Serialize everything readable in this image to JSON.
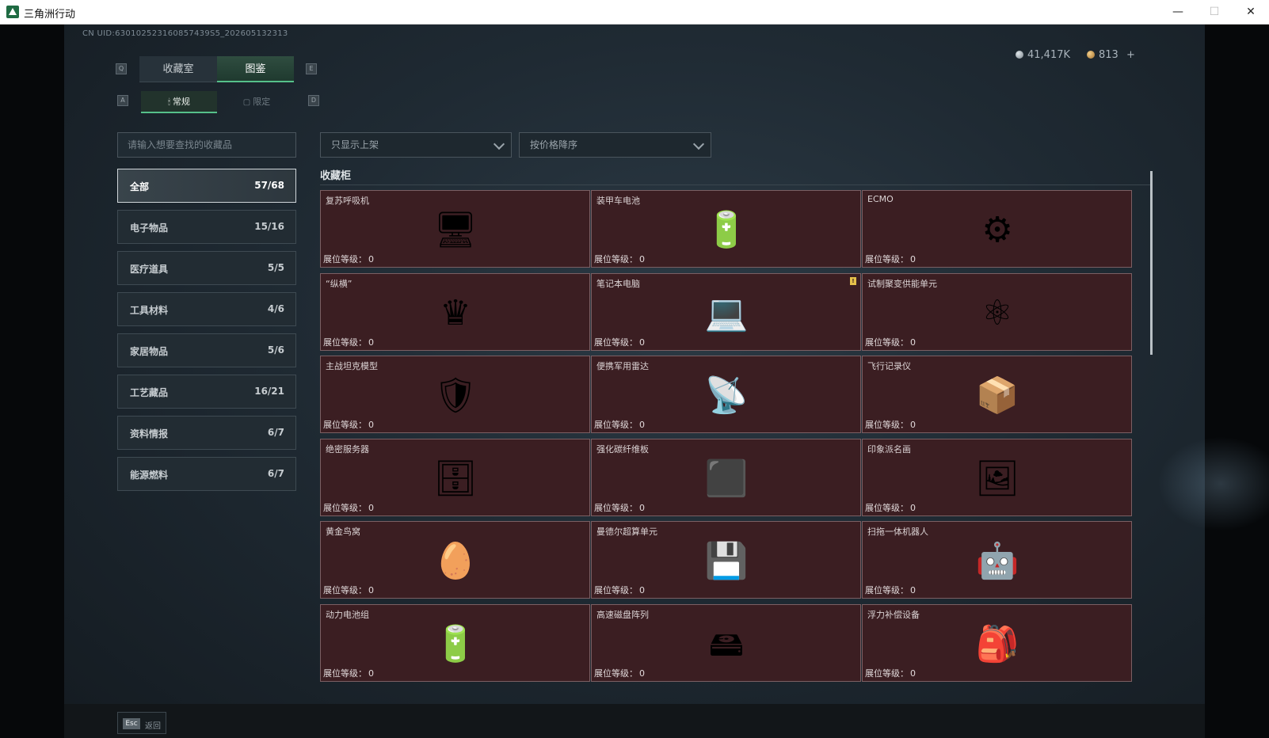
{
  "window": {
    "title": "三角洲行动",
    "minimize": "—",
    "maximize": "☐",
    "close": "✕"
  },
  "header": {
    "uid": "CN UID:630102523160857439S5_202605132313",
    "currency_silver": "41,417K",
    "currency_gold": "813",
    "add_label": "+"
  },
  "tabs": [
    {
      "label": "收藏室",
      "key": "Q"
    },
    {
      "label": "图鉴",
      "key": "E"
    }
  ],
  "subtabs": [
    {
      "label": "常规",
      "key": "A",
      "icon": "🕯"
    },
    {
      "label": "限定",
      "key": "D",
      "icon": "▢"
    }
  ],
  "search": {
    "placeholder": "请输入想要查找的收藏品"
  },
  "categories": [
    {
      "label": "全部",
      "count": "57/68"
    },
    {
      "label": "电子物品",
      "count": "15/16"
    },
    {
      "label": "医疗道具",
      "count": "5/5"
    },
    {
      "label": "工具材料",
      "count": "4/6"
    },
    {
      "label": "家居物品",
      "count": "5/6"
    },
    {
      "label": "工艺藏品",
      "count": "16/21"
    },
    {
      "label": "资料情报",
      "count": "6/7"
    },
    {
      "label": "能源燃料",
      "count": "6/7"
    }
  ],
  "filters": {
    "show_listed": "只显示上架",
    "sort": "按价格降序"
  },
  "section": {
    "title": "收藏柜"
  },
  "level_label": "展位等级：",
  "items": [
    {
      "name": "复苏呼吸机",
      "level": "0",
      "icon": "ventilator-icon",
      "glyph": "🖥"
    },
    {
      "name": "装甲车电池",
      "level": "0",
      "icon": "battery-icon",
      "glyph": "🔋"
    },
    {
      "name": "ECMO",
      "level": "0",
      "icon": "ecmo-icon",
      "glyph": "⚙"
    },
    {
      "name": "“纵横”",
      "level": "0",
      "icon": "chessboard-icon",
      "glyph": "♛"
    },
    {
      "name": "笔记本电脑",
      "level": "0",
      "icon": "laptop-icon",
      "glyph": "💻",
      "badge": "!"
    },
    {
      "name": "试制聚变供能单元",
      "level": "0",
      "icon": "fusion-cell-icon",
      "glyph": "⚛"
    },
    {
      "name": "主战坦克模型",
      "level": "0",
      "icon": "tank-icon",
      "glyph": "🛡"
    },
    {
      "name": "便携军用雷达",
      "level": "0",
      "icon": "radar-icon",
      "glyph": "📡"
    },
    {
      "name": "飞行记录仪",
      "level": "0",
      "icon": "flight-recorder-icon",
      "glyph": "📦"
    },
    {
      "name": "绝密服务器",
      "level": "0",
      "icon": "server-icon",
      "glyph": "🗄"
    },
    {
      "name": "强化碳纤维板",
      "level": "0",
      "icon": "carbon-plate-icon",
      "glyph": "⬛"
    },
    {
      "name": "印象派名画",
      "level": "0",
      "icon": "painting-icon",
      "glyph": "🖼"
    },
    {
      "name": "黄金鸟窝",
      "level": "0",
      "icon": "golden-nest-icon",
      "glyph": "🥚"
    },
    {
      "name": "曼德尔超算单元",
      "level": "0",
      "icon": "supercomputer-icon",
      "glyph": "💾"
    },
    {
      "name": "扫拖一体机器人",
      "level": "0",
      "icon": "robot-vacuum-icon",
      "glyph": "🤖"
    },
    {
      "name": "动力电池组",
      "level": "0",
      "icon": "battery-pack-icon",
      "glyph": "🔋"
    },
    {
      "name": "高速磁盘阵列",
      "level": "0",
      "icon": "disk-array-icon",
      "glyph": "🖴"
    },
    {
      "name": "浮力补偿设备",
      "level": "0",
      "icon": "buoyancy-device-icon",
      "glyph": "🎒"
    }
  ],
  "footer": {
    "esc_key": "Esc",
    "esc_label": "返回"
  }
}
